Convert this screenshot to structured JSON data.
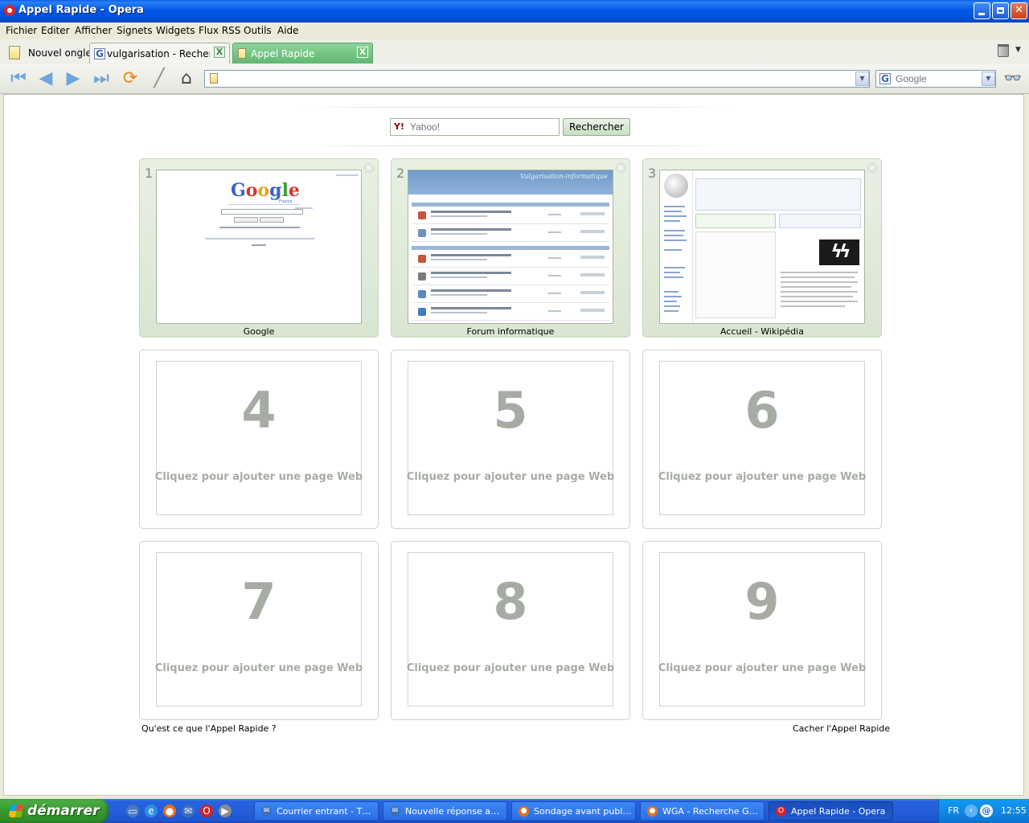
{
  "window": {
    "title": "Appel Rapide - Opera"
  },
  "menu": [
    "Fichier",
    "Editer",
    "Afficher",
    "Signets",
    "Widgets",
    "Flux RSS",
    "Outils",
    "Aide"
  ],
  "tabs": {
    "new_tab": "Nouvel onglet",
    "items": [
      {
        "label": "vulgarisation - Recherch...",
        "icon": "google-favicon"
      },
      {
        "label": "Appel Rapide",
        "icon": "document-icon",
        "active": true
      }
    ],
    "close_glyph": "X"
  },
  "address": {
    "value": ""
  },
  "search_engine": {
    "placeholder": "Google"
  },
  "speed_dial": {
    "search_placeholder": "Yahoo!",
    "search_button": "Rechercher",
    "filled": [
      {
        "num": "1",
        "title": "Google",
        "thumb": "google"
      },
      {
        "num": "2",
        "title": "Forum informatique",
        "thumb": "forum"
      },
      {
        "num": "3",
        "title": "Accueil - Wikipédia",
        "thumb": "wiki"
      }
    ],
    "empty": [
      {
        "num": "4",
        "hint": "Cliquez pour ajouter une page Web"
      },
      {
        "num": "5",
        "hint": "Cliquez pour ajouter une page Web"
      },
      {
        "num": "6",
        "hint": "Cliquez pour ajouter une page Web"
      },
      {
        "num": "7",
        "hint": "Cliquez pour ajouter une page Web"
      },
      {
        "num": "8",
        "hint": "Cliquez pour ajouter une page Web"
      },
      {
        "num": "9",
        "hint": "Cliquez pour ajouter une page Web"
      }
    ],
    "help_link": "Qu'est ce que l'Appel Rapide ?",
    "hide_link": "Cacher l'Appel Rapide",
    "thumb_text": {
      "google_logo": "Google",
      "google_sub": "France",
      "forum_title": "Vulgarisation-informatique"
    }
  },
  "taskbar": {
    "start_label": "démarrer",
    "tasks": [
      {
        "label": "Courrier entrant - Th...",
        "icon": "thunderbird-icon"
      },
      {
        "label": "Nouvelle réponse app...",
        "icon": "thunderbird-icon"
      },
      {
        "label": "Sondage avant public...",
        "icon": "firefox-icon"
      },
      {
        "label": "WGA - Recherche Go...",
        "icon": "firefox-icon"
      },
      {
        "label": "Appel Rapide - Opera",
        "icon": "opera-icon",
        "active": true
      }
    ],
    "tray": {
      "language": "FR",
      "clock": "12:55"
    }
  },
  "colors": {
    "titlebar": "#0058e6",
    "active_tab": "#5fb870",
    "dial_fill": "#d9e6d2",
    "taskbar": "#245edb",
    "start": "#37982f"
  }
}
